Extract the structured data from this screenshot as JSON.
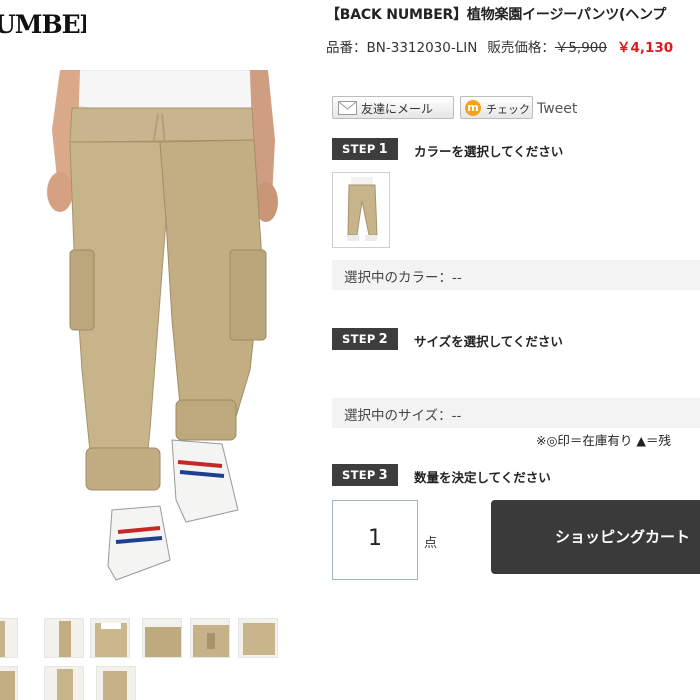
{
  "brand": {
    "logo_text": "UMBER",
    "logo_mark": "®"
  },
  "product": {
    "title": "【BACK NUMBER】植物楽園イージーパンツ(ヘンプ",
    "code_label": "品番：",
    "code": "BN-3312030-LIN",
    "price_label": "販売価格：",
    "old_price": "￥5,900",
    "price": "￥4,130"
  },
  "social": {
    "mail_label": "友達にメール",
    "check_label": "チェック",
    "check_icon": "m",
    "tweet_label": "Tweet"
  },
  "steps": [
    {
      "badge": "STEP",
      "num": "1",
      "text": "カラーを選択してください"
    },
    {
      "badge": "STEP",
      "num": "2",
      "text": "サイズを選択してください"
    },
    {
      "badge": "STEP",
      "num": "3",
      "text": "数量を決定してください"
    }
  ],
  "selection": {
    "color": "選択中のカラー：--",
    "size": "選択中のサイズ：--"
  },
  "stock_note": "※◎印＝在庫有り ▲＝残",
  "quantity": {
    "value": "1",
    "unit": "点"
  },
  "cart_button": "ショッピングカート",
  "colors": {
    "accent_red": "#e01b1b",
    "badge_bg": "#3d3d3d",
    "cart_bg": "#3a3a3a",
    "khaki": "#c8b48a"
  }
}
